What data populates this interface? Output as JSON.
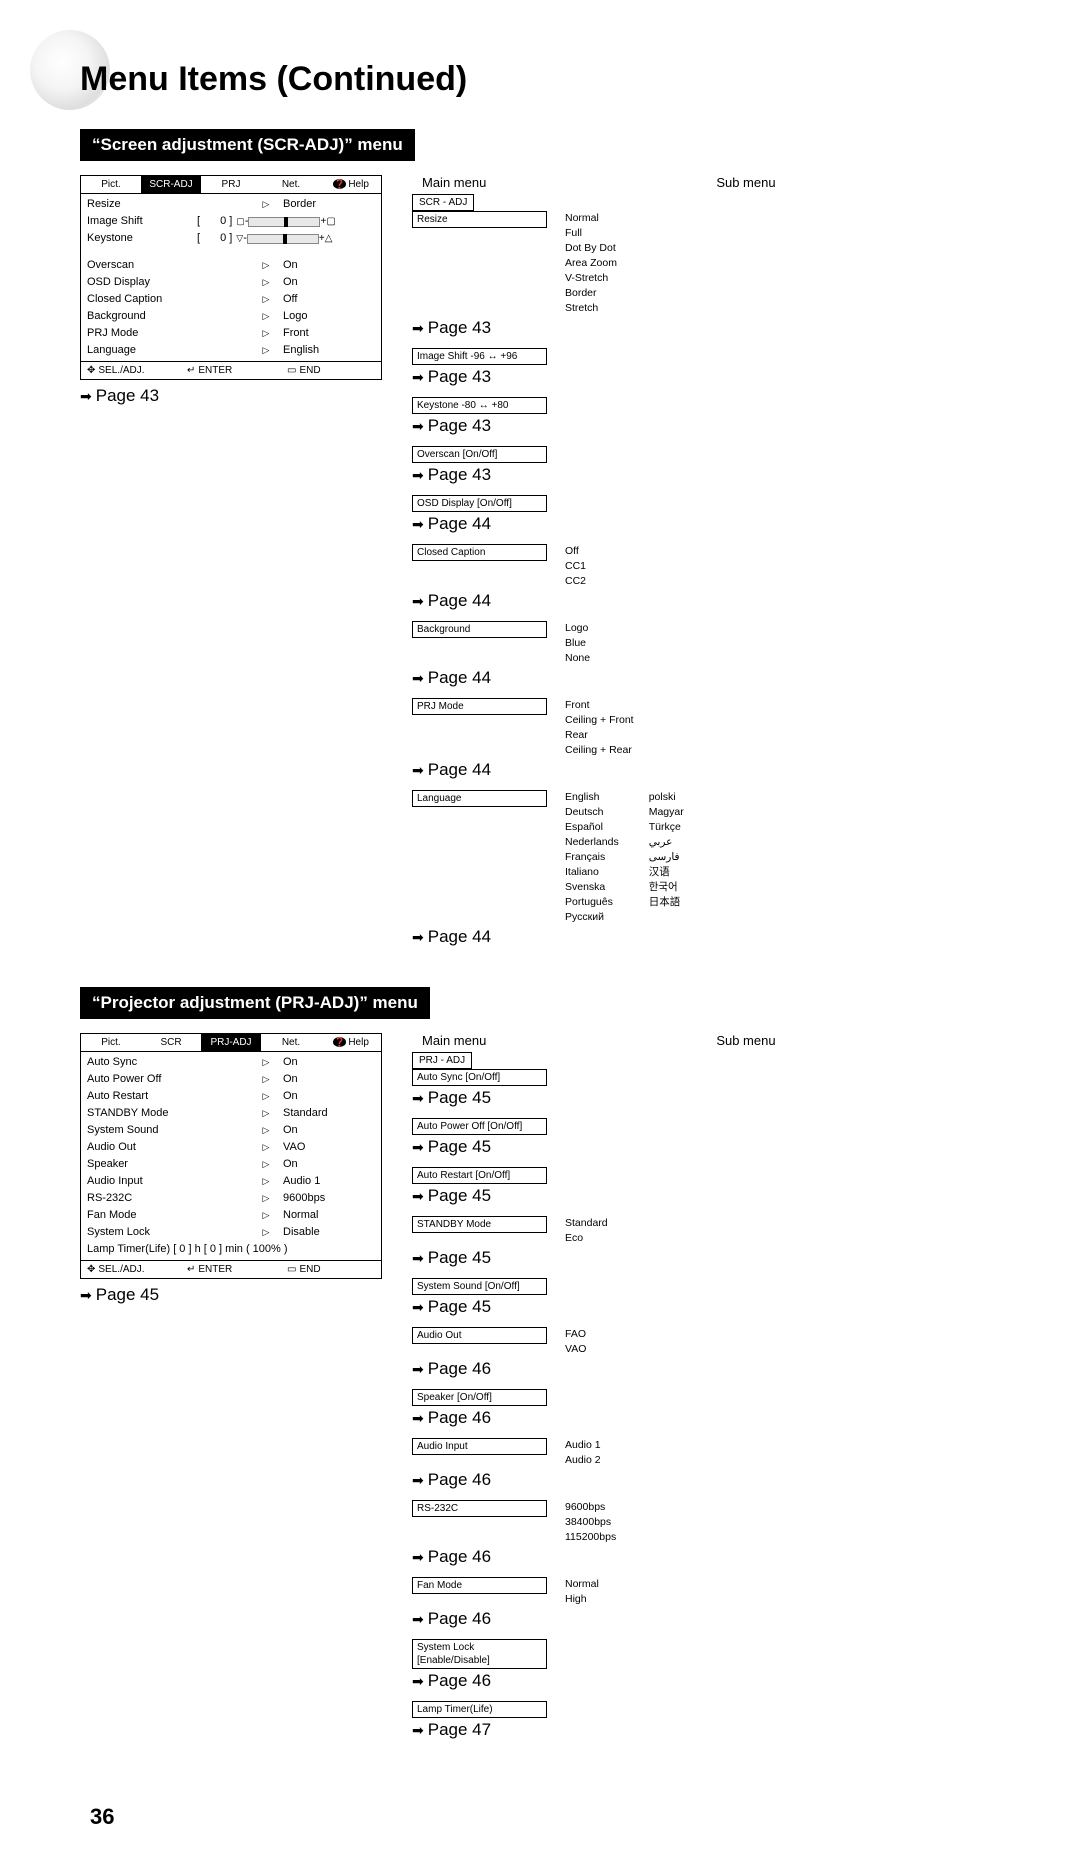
{
  "page_title": "Menu Items (Continued)",
  "page_number": "36",
  "sections": [
    {
      "bar": "“Screen adjustment (SCR-ADJ)” menu",
      "osd": {
        "tabs": [
          "Pict.",
          "SCR-ADJ",
          "PRJ",
          "Net.",
          "Help"
        ],
        "active_tab": 1,
        "rows": [
          {
            "label": "Resize",
            "sym": "▷",
            "value": "Border"
          },
          {
            "label": "Image Shift",
            "bracket": "[",
            "num": "0 ]",
            "slider": true,
            "plus": "+▢"
          },
          {
            "label": "Keystone",
            "bracket": "[",
            "num": "0 ]",
            "slider_tri": true,
            "plus": "+△"
          },
          {
            "label": "Overscan",
            "sym": "▷",
            "value": "On"
          },
          {
            "label": "OSD Display",
            "sym": "▷",
            "value": "On"
          },
          {
            "label": "Closed Caption",
            "sym": "▷",
            "value": "Off"
          },
          {
            "label": "Background",
            "sym": "▷",
            "value": "Logo"
          },
          {
            "label": "PRJ Mode",
            "sym": "▷",
            "value": "Front"
          },
          {
            "label": "Language",
            "sym": "▷",
            "value": "English"
          }
        ],
        "footer": [
          "SEL./ADJ.",
          "ENTER",
          "END"
        ]
      },
      "first_page_ref": "Page 43",
      "headers": {
        "main": "Main menu",
        "sub": "Sub menu"
      },
      "root": "SCR - ADJ",
      "tree": [
        {
          "main": "Resize",
          "page": "Page 43",
          "sub": [
            "Normal",
            "Full",
            "Dot By Dot",
            "Area Zoom",
            "V-Stretch",
            "Border",
            "Stretch"
          ]
        },
        {
          "main": "Image Shift    -96 ↔ +96",
          "page": "Page 43"
        },
        {
          "main": "Keystone       -80 ↔ +80",
          "page": "Page 43"
        },
        {
          "main": "Overscan [On/Off]",
          "page": "Page 43"
        },
        {
          "main": "OSD Display [On/Off]",
          "page": "Page 44"
        },
        {
          "main": "Closed Caption",
          "page": "Page 44",
          "sub": [
            "Off",
            "CC1",
            "CC2"
          ]
        },
        {
          "main": "Background",
          "page": "Page 44",
          "sub": [
            "Logo",
            "Blue",
            "None"
          ]
        },
        {
          "main": "PRJ Mode",
          "page": "Page 44",
          "sub": [
            "Front",
            "Ceiling + Front",
            "Rear",
            "Ceiling + Rear"
          ]
        },
        {
          "main": "Language",
          "page": "Page 44",
          "sub_two": [
            [
              "English",
              "Deutsch",
              "Español",
              "Nederlands",
              "Français",
              "Italiano",
              "Svenska",
              "Português",
              "Русский"
            ],
            [
              "polski",
              "Magyar",
              "Türkçe",
              "عربي",
              "فارسی",
              "汉语",
              "한국어",
              "日本語"
            ]
          ]
        }
      ]
    },
    {
      "bar": "“Projector adjustment (PRJ-ADJ)” menu",
      "osd": {
        "tabs": [
          "Pict.",
          "SCR",
          "PRJ-ADJ",
          "Net.",
          "Help"
        ],
        "active_tab": 2,
        "rows": [
          {
            "label": "Auto Sync",
            "sym": "▷",
            "value": "On"
          },
          {
            "label": "Auto Power Off",
            "sym": "▷",
            "value": "On"
          },
          {
            "label": "Auto Restart",
            "sym": "▷",
            "value": "On"
          },
          {
            "label": "STANDBY Mode",
            "sym": "▷",
            "value": "Standard"
          },
          {
            "label": "System Sound",
            "sym": "▷",
            "value": "On"
          },
          {
            "label": "Audio Out",
            "sym": "▷",
            "value": "VAO"
          },
          {
            "label": "Speaker",
            "sym": "▷",
            "value": "On"
          },
          {
            "label": "Audio Input",
            "sym": "▷",
            "value": "Audio 1"
          },
          {
            "label": "RS-232C",
            "sym": "▷",
            "value": "9600bps"
          },
          {
            "label": "Fan Mode",
            "sym": "▷",
            "value": "Normal"
          },
          {
            "label": "System Lock",
            "sym": "▷",
            "value": "Disable"
          },
          {
            "label": "Lamp Timer(Life)   [          0 ] h              [         0 ] min ( 100% )"
          }
        ],
        "footer": [
          "SEL./ADJ.",
          "ENTER",
          "END"
        ]
      },
      "first_page_ref": "Page 45",
      "headers": {
        "main": "Main menu",
        "sub": "Sub menu"
      },
      "root": "PRJ - ADJ",
      "tree": [
        {
          "main": "Auto Sync [On/Off]",
          "page": "Page 45"
        },
        {
          "main": "Auto Power Off [On/Off]",
          "page": "Page 45"
        },
        {
          "main": "Auto Restart [On/Off]",
          "page": "Page 45"
        },
        {
          "main": "STANDBY Mode",
          "page": "Page 45",
          "sub": [
            "Standard",
            "Eco"
          ]
        },
        {
          "main": "System Sound [On/Off]",
          "page": "Page 45"
        },
        {
          "main": "Audio Out",
          "page": "Page 46",
          "sub": [
            "FAO",
            "VAO"
          ]
        },
        {
          "main": "Speaker [On/Off]",
          "page": "Page 46"
        },
        {
          "main": "Audio Input",
          "page": "Page 46",
          "sub": [
            "Audio 1",
            "Audio 2"
          ]
        },
        {
          "main": "RS-232C",
          "page": "Page 46",
          "sub": [
            "9600bps",
            "38400bps",
            "115200bps"
          ]
        },
        {
          "main": "Fan Mode",
          "page": "Page 46",
          "sub": [
            "Normal",
            "High"
          ]
        },
        {
          "main": "System Lock\n[Enable/Disable]",
          "page": "Page 46"
        },
        {
          "main": "Lamp Timer(Life)",
          "page": "Page 47"
        }
      ]
    }
  ]
}
